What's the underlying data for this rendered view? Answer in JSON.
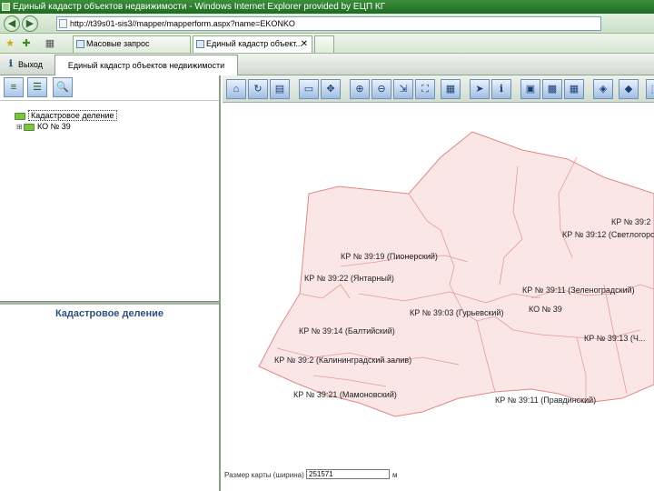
{
  "browser": {
    "title": "Единый кадастр объектов недвижимости - Windows Internet Explorer provided by ЕЦП КГ",
    "url": "http://t39s01-sis3//mapper/mapperform.aspx?name=EKONKO",
    "tabs": [
      {
        "label": "Масовые запрос"
      },
      {
        "label": "Единый кадастр объект...",
        "close": "✕"
      }
    ]
  },
  "app": {
    "exit_label": "Выход",
    "tab_title": "Единый кадастр объектов недвижимости"
  },
  "tree": {
    "root_label": "Кадастровое деление",
    "child_expander": "⊞",
    "child_label": "КО № 39"
  },
  "details": {
    "title": "Кадастровое деление"
  },
  "map": {
    "labels": {
      "kr_pionersky": "КР № 39:19 (Пионерский)",
      "kr_yantarny": "КР № 39:22 (Янтарный)",
      "kr_guryevsky": "КР № 39:03 (Гурьевский)",
      "kr_zelenogradsky": "КР № 39:11 (Зеленоградский)",
      "ko_39": "КО № 39",
      "kr_baltiysky": "КР № 39:14 (Балтийский)",
      "kr_svetlogorsky": "КР № 39:12 (Светлогорский)",
      "kr_39_2": "КР № 39:2",
      "kr_kaliningradsky": "КР № 39:2 (Калининградский залив)",
      "kr_mamonovsky": "КР № 39:21 (Мамоновский)",
      "kr_pravdinsky": "КР № 39:11 (Правдинский)",
      "kr_13": "КР № 39:13 (Ч..."
    }
  },
  "status": {
    "scale_label": "Размер карты (ширина)",
    "scale_value": "251571",
    "scale_unit": "м"
  }
}
